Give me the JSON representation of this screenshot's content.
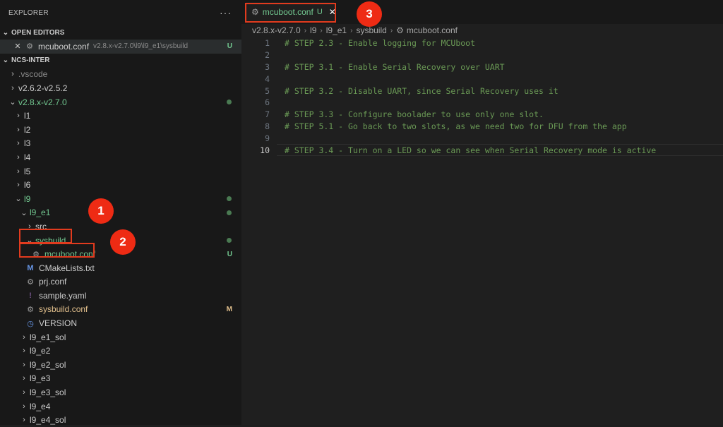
{
  "explorer": {
    "title": "EXPLORER",
    "more": "···"
  },
  "open_editors": {
    "header": "OPEN EDITORS",
    "items": [
      {
        "name": "mcuboot.conf",
        "path": "v2.8.x-v2.7.0\\l9\\l9_e1\\sysbuild",
        "status": "U"
      }
    ]
  },
  "workspace": {
    "header": "NCS-INTER",
    "tree": [
      {
        "label": ".vscode",
        "chev": "›",
        "indent": 0,
        "color": "muted"
      },
      {
        "label": "v2.6.2-v2.5.2",
        "chev": "›",
        "indent": 0
      },
      {
        "label": "v2.8.x-v2.7.0",
        "chev": "⌄",
        "indent": 0,
        "color": "green",
        "dot": true
      },
      {
        "label": "l1",
        "chev": "›",
        "indent": 1
      },
      {
        "label": "l2",
        "chev": "›",
        "indent": 1
      },
      {
        "label": "l3",
        "chev": "›",
        "indent": 1
      },
      {
        "label": "l4",
        "chev": "›",
        "indent": 1
      },
      {
        "label": "l5",
        "chev": "›",
        "indent": 1
      },
      {
        "label": "l6",
        "chev": "›",
        "indent": 1
      },
      {
        "label": "l9",
        "chev": "⌄",
        "indent": 1,
        "color": "green",
        "dot": true
      },
      {
        "label": "l9_e1",
        "chev": "⌄",
        "indent": 2,
        "color": "green",
        "dot": true
      },
      {
        "label": "src",
        "chev": "›",
        "indent": 3
      },
      {
        "label": "sysbuild",
        "chev": "⌄",
        "indent": 3,
        "color": "green",
        "dot": true
      },
      {
        "label": "mcuboot.conf",
        "icon": "gear",
        "indent": 4,
        "color": "green",
        "status": "U",
        "statusColor": "green"
      },
      {
        "label": "CMakeLists.txt",
        "icon": "cmake",
        "indent": 3
      },
      {
        "label": "prj.conf",
        "icon": "gear",
        "indent": 3
      },
      {
        "label": "sample.yaml",
        "icon": "exclam",
        "indent": 3
      },
      {
        "label": "sysbuild.conf",
        "icon": "gear",
        "indent": 3,
        "color": "yellow",
        "status": "M",
        "statusColor": "yellow"
      },
      {
        "label": "VERSION",
        "icon": "clock",
        "indent": 3
      },
      {
        "label": "l9_e1_sol",
        "chev": "›",
        "indent": 2
      },
      {
        "label": "l9_e2",
        "chev": "›",
        "indent": 2
      },
      {
        "label": "l9_e2_sol",
        "chev": "›",
        "indent": 2
      },
      {
        "label": "l9_e3",
        "chev": "›",
        "indent": 2
      },
      {
        "label": "l9_e3_sol",
        "chev": "›",
        "indent": 2
      },
      {
        "label": "l9_e4",
        "chev": "›",
        "indent": 2
      },
      {
        "label": "l9_e4_sol",
        "chev": "›",
        "indent": 2
      }
    ]
  },
  "tab": {
    "name": "mcuboot.conf",
    "status": "U",
    "close": "✕"
  },
  "breadcrumb": [
    "v2.8.x-v2.7.0",
    "l9",
    "l9_e1",
    "sysbuild",
    "mcuboot.conf"
  ],
  "code": {
    "active_line": 10,
    "lines": [
      "# STEP 2.3 - Enable logging for MCUboot",
      "",
      "# STEP 3.1 - Enable Serial Recovery over UART",
      "",
      "# STEP 3.2 - Disable UART, since Serial Recovery uses it",
      "",
      "# STEP 3.3 - Configure boolader to use only one slot.",
      "# STEP 5.1 - Go back to two slots, as we need two for DFU from the app",
      "",
      "# STEP 3.4 - Turn on a LED so we can see when Serial Recovery mode is active"
    ]
  },
  "annotations": {
    "badges": [
      "1",
      "2",
      "3"
    ],
    "color": "#e23b1e"
  }
}
